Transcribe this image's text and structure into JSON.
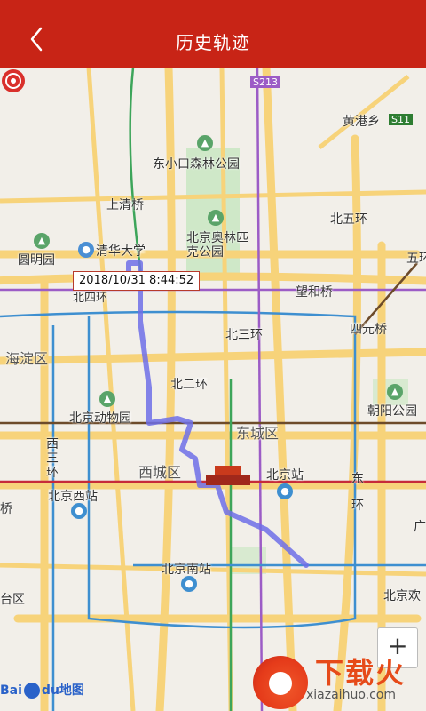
{
  "header": {
    "title": "历史轨迹",
    "back_icon": "chevron-left-icon"
  },
  "map": {
    "labels": [
      {
        "key": "s213",
        "text": "S213"
      },
      {
        "key": "huanggang",
        "text": "黄港乡"
      },
      {
        "key": "s11",
        "text": "S11"
      },
      {
        "key": "forest_park",
        "text": "东小口森林公园"
      },
      {
        "key": "shangqingqiao",
        "text": "上清桥"
      },
      {
        "key": "beiwuhuan",
        "text": "北五环"
      },
      {
        "key": "yuanmingyuan",
        "text": "圆明园"
      },
      {
        "key": "tsinghua",
        "text": "清华大学"
      },
      {
        "key": "olympic",
        "text": "北京奥林匹克公园"
      },
      {
        "key": "wuhuan",
        "text": "五环"
      },
      {
        "key": "beisihuan",
        "text": "北四环"
      },
      {
        "key": "wangjingqiao",
        "text": "望和桥"
      },
      {
        "key": "haidian",
        "text": "海淀区"
      },
      {
        "key": "beisanhuan",
        "text": "北三环"
      },
      {
        "key": "siyuanqiao",
        "text": "四元桥"
      },
      {
        "key": "beierhuan",
        "text": "北二环"
      },
      {
        "key": "zoo",
        "text": "北京动物园"
      },
      {
        "key": "dongcheng",
        "text": "东城区"
      },
      {
        "key": "chaoyang_park",
        "text": "朝阳公园"
      },
      {
        "key": "xisanhuan",
        "text": "西三环"
      },
      {
        "key": "xicheng",
        "text": "西城区"
      },
      {
        "key": "beijing_station",
        "text": "北京站"
      },
      {
        "key": "dong",
        "text": "东"
      },
      {
        "key": "huan",
        "text": "环"
      },
      {
        "key": "beijing_west",
        "text": "北京西站"
      },
      {
        "key": "qiao",
        "text": "桥"
      },
      {
        "key": "guang",
        "text": "广"
      },
      {
        "key": "beijing_south",
        "text": "北京南站"
      },
      {
        "key": "fengtai",
        "text": "台区"
      },
      {
        "key": "beijing_huan",
        "text": "北京欢"
      }
    ],
    "tooltip": "2018/10/31 8:44:52",
    "zoom_label": "+",
    "attribution": {
      "brand": "Bai",
      "brand2": "du",
      "suffix": "地图"
    }
  },
  "watermark": {
    "title": "下载火",
    "url": "xiazaihuo.com"
  },
  "colors": {
    "header_bg": "#c82416",
    "track": "#6f6fe8",
    "ring_road": "#f7d37a",
    "subway_blue": "#3e8fd0",
    "subway_purple": "#9c5cc6",
    "subway_green": "#3da55a"
  }
}
